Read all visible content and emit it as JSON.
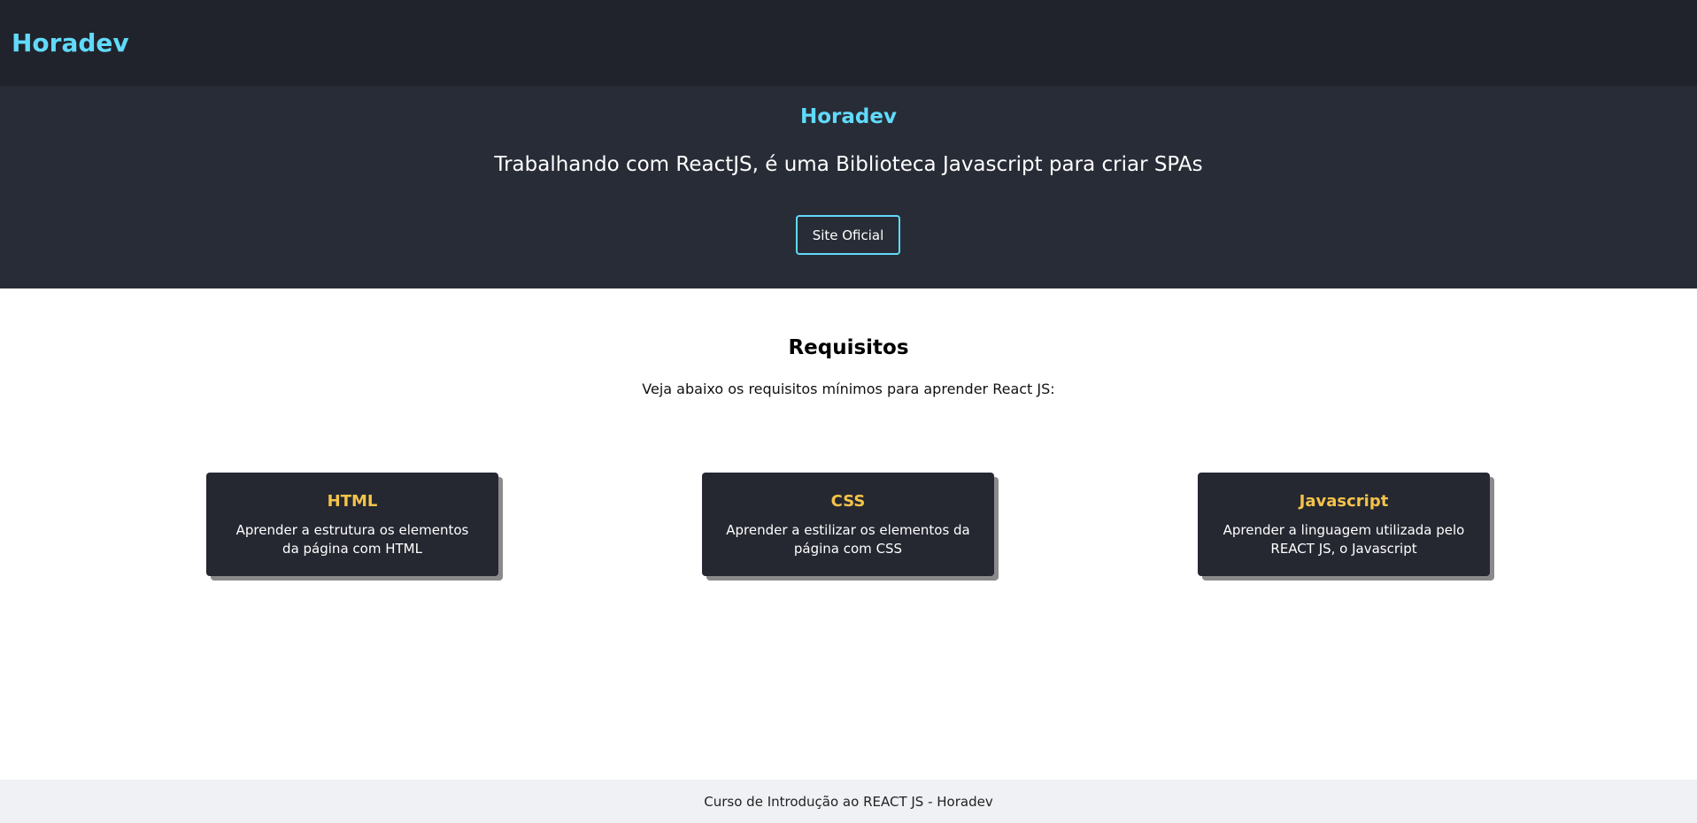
{
  "header": {
    "brand": "Horadev"
  },
  "hero": {
    "title": "Horadev",
    "subtitle": "Trabalhando com ReactJS, é uma Biblioteca Javascript para criar SPAs",
    "button_label": "Site Oficial"
  },
  "requirements": {
    "title": "Requisitos",
    "subtitle": "Veja abaixo os requisitos mínimos para aprender React JS:",
    "cards": [
      {
        "title": "HTML",
        "text": "Aprender a estrutura os elementos da página com HTML"
      },
      {
        "title": "CSS",
        "text": "Aprender a estilizar os elementos da página com CSS"
      },
      {
        "title": "Javascript",
        "text": "Aprender a linguagem utilizada pelo REACT JS, o Javascript"
      }
    ]
  },
  "footer": {
    "text": "Curso de Introdução ao REACT JS - Horadev"
  },
  "colors": {
    "header_bg": "#21232c",
    "hero_bg": "#282c36",
    "accent": "#61dafb",
    "card_bg": "#252831",
    "card_title": "#f5c34a",
    "footer_bg": "#f0f1f5"
  }
}
